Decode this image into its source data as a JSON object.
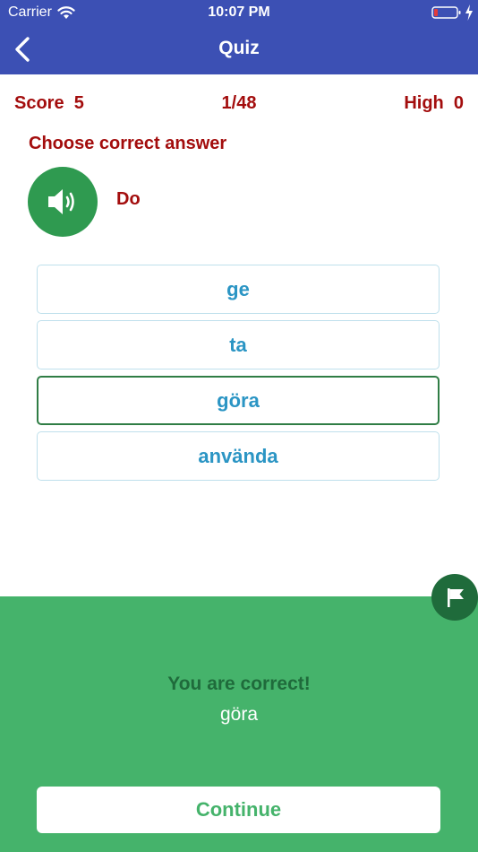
{
  "status_bar": {
    "carrier": "Carrier",
    "time": "10:07 PM"
  },
  "nav": {
    "title": "Quiz"
  },
  "stats": {
    "score_label": "Score  5",
    "progress": "1/48",
    "high_label": "High  0"
  },
  "question": {
    "instruction": "Choose correct answer",
    "word": "Do"
  },
  "options": [
    "ge",
    "ta",
    "göra",
    "använda"
  ],
  "selected_option": "göra",
  "feedback": {
    "message": "You are correct!",
    "answer": "göra",
    "continue_label": "Continue"
  },
  "colors": {
    "header": "#3c50b4",
    "accent_red": "#a30d0d",
    "option_text": "#2b95c4",
    "success_panel": "#45b36b",
    "success_dark": "#1f6b3b"
  },
  "icons": {
    "back": "chevron-left-icon",
    "audio": "speaker-icon",
    "report": "flag-icon"
  }
}
